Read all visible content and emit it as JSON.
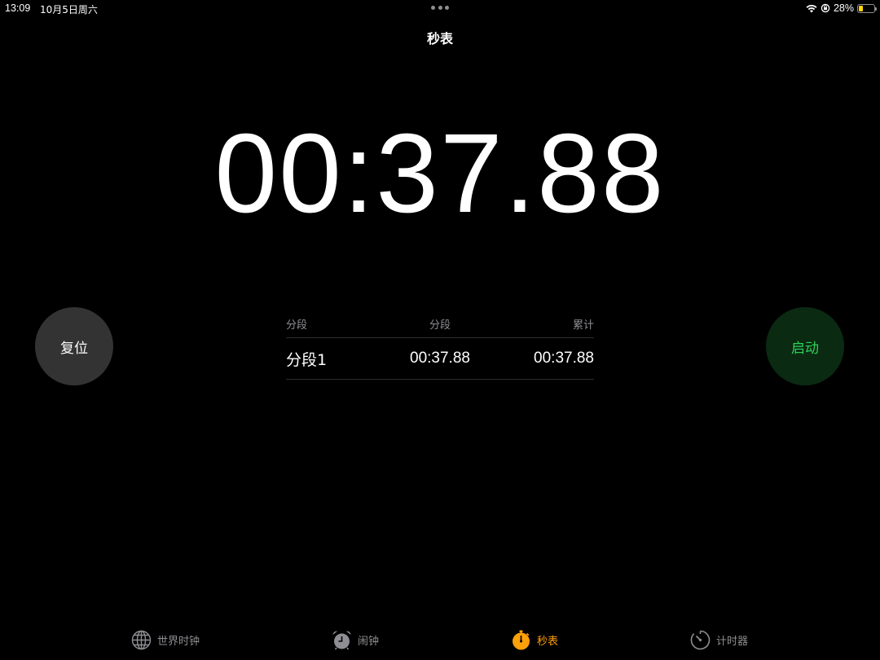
{
  "status_bar": {
    "time": "13:09",
    "date": "10月5日周六",
    "battery_percent": "28%",
    "battery_level": 0.28,
    "battery_color": "#ffd60a"
  },
  "header": {
    "title": "秒表"
  },
  "stopwatch": {
    "display": "00:37.88"
  },
  "buttons": {
    "reset_label": "复位",
    "start_label": "启动",
    "start_color": "#30d158"
  },
  "laps": {
    "columns": [
      "分段",
      "分段",
      "累计"
    ],
    "rows": [
      {
        "name": "分段1",
        "split": "00:37.88",
        "total": "00:37.88"
      }
    ]
  },
  "tab_bar": {
    "active_color": "#ff9f0a",
    "items": [
      {
        "label": "世界时钟",
        "icon": "globe-icon"
      },
      {
        "label": "闹钟",
        "icon": "alarm-clock-icon"
      },
      {
        "label": "秒表",
        "icon": "stopwatch-icon",
        "active": true
      },
      {
        "label": "计时器",
        "icon": "timer-icon"
      }
    ]
  }
}
